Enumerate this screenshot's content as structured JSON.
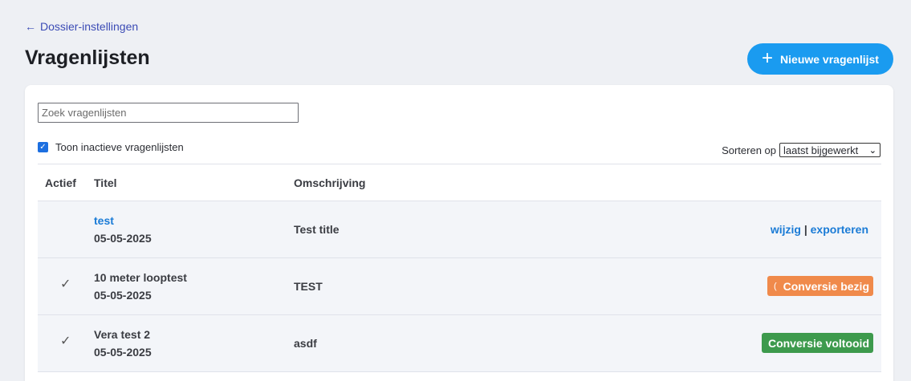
{
  "nav": {
    "back_label": "Dossier-instellingen"
  },
  "page": {
    "title": "Vragenlijsten",
    "new_button_label": "Nieuwe vragenlijst"
  },
  "filters": {
    "search_placeholder": "Zoek vragenlijsten",
    "show_inactive_label": "Toon inactieve vragenlijsten",
    "show_inactive_checked": true,
    "sort_label": "Sorteren op",
    "sort_value": "laatst bijgewerkt"
  },
  "table": {
    "headers": {
      "active": "Actief",
      "title": "Titel",
      "description": "Omschrijving"
    },
    "rows": [
      {
        "active": "",
        "title": "test",
        "date": "05-05-2025",
        "description": "Test title",
        "action_edit": "wijzig",
        "action_sep": "|",
        "action_export": "exporteren"
      },
      {
        "active": "✓",
        "title": "10 meter looptest",
        "date": "05-05-2025",
        "description": "TEST",
        "status": "Conversie bezig",
        "status_color": "#f08a4b"
      },
      {
        "active": "✓",
        "title": "Vera test 2",
        "date": "05-05-2025",
        "description": "asdf",
        "status": "Conversie voltooid",
        "status_color": "#3d9a4d"
      }
    ]
  },
  "colors": {
    "accent": "#1a9bf0",
    "link": "#1a7bd6",
    "back_link": "#3b4bb5"
  }
}
